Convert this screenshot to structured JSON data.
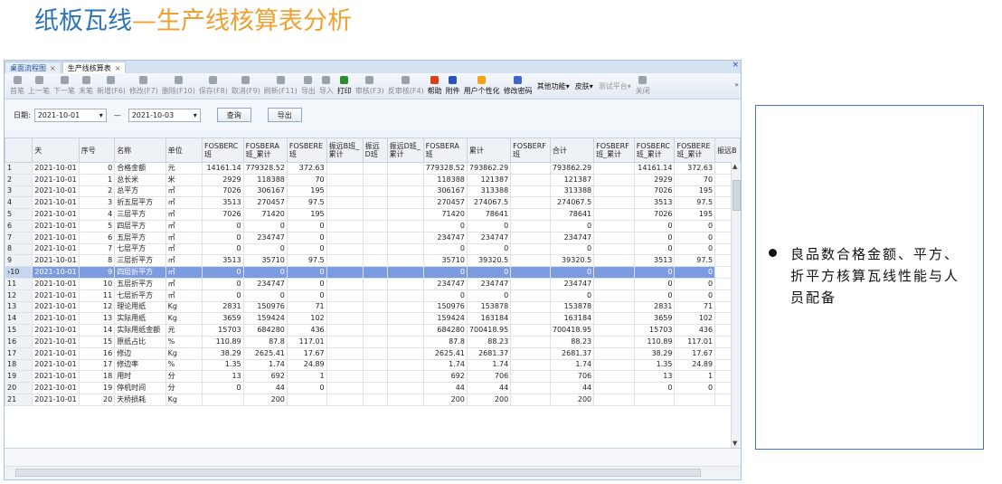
{
  "slide": {
    "title_main": "纸板瓦线",
    "title_accent": "—生产线核算表分析"
  },
  "tabs": [
    {
      "label": "桌面流程图",
      "close": "×"
    },
    {
      "label": "生产线核算表",
      "close": "×"
    }
  ],
  "window_close": "×",
  "toolbar": {
    "buttons": [
      "首笔",
      "上一笔",
      "下一笔",
      "末笔",
      "新增(F6)",
      "修改(F7)",
      "删除(F10)",
      "保存(F8)",
      "取消(F9)",
      "刷新(F11)",
      "导出",
      "导入",
      "打印",
      "审核(F3)",
      "反审核(F4)",
      "帮助",
      "附件",
      "用户个性化",
      "修改密码"
    ],
    "dropdowns": [
      "其他功能",
      "皮肤",
      "测试平台"
    ],
    "close_label": "关闭",
    "more": "»"
  },
  "filter": {
    "label": "日期:",
    "start": "2021-10-01",
    "end": "2021-10-03",
    "dash": "—",
    "query": "查询",
    "export": "导出"
  },
  "columns": [
    "天",
    "序号",
    "名称",
    "单位",
    "FOSBERC班",
    "FOSBERA班_累计",
    "FOSBERE班",
    "振远B班_累计",
    "振远D班",
    "振远D班_累计",
    "FOSBERA班",
    "累计",
    "FOSBERF班",
    "合计",
    "FOSBERF班_累计",
    "FOSBERC班_累计",
    "FOSBERE班_累计",
    "振远B"
  ],
  "rows": [
    {
      "no": "1",
      "day": "2021-10-01",
      "seq": "0",
      "name": "合格金额",
      "unit": "元",
      "c": [
        "14161.14",
        "779328.52",
        "372.63",
        "",
        "",
        "",
        "779328.52",
        "793862.29",
        "",
        "793862.29",
        "",
        "14161.14",
        "372.63"
      ]
    },
    {
      "no": "2",
      "day": "2021-10-01",
      "seq": "1",
      "name": "总长米",
      "unit": "米",
      "c": [
        "2929",
        "118388",
        "70",
        "",
        "",
        "",
        "118388",
        "121387",
        "",
        "121387",
        "",
        "2929",
        "70"
      ]
    },
    {
      "no": "3",
      "day": "2021-10-01",
      "seq": "2",
      "name": "总平方",
      "unit": "㎡",
      "c": [
        "7026",
        "306167",
        "195",
        "",
        "",
        "",
        "306167",
        "313388",
        "",
        "313388",
        "",
        "7026",
        "195"
      ]
    },
    {
      "no": "4",
      "day": "2021-10-01",
      "seq": "3",
      "name": "折五层平方",
      "unit": "㎡",
      "c": [
        "3513",
        "270457",
        "97.5",
        "",
        "",
        "",
        "270457",
        "274067.5",
        "",
        "274067.5",
        "",
        "3513",
        "97.5"
      ]
    },
    {
      "no": "5",
      "day": "2021-10-01",
      "seq": "4",
      "name": "三层平方",
      "unit": "㎡",
      "c": [
        "7026",
        "71420",
        "195",
        "",
        "",
        "",
        "71420",
        "78641",
        "",
        "78641",
        "",
        "7026",
        "195"
      ]
    },
    {
      "no": "6",
      "day": "2021-10-01",
      "seq": "5",
      "name": "四层平方",
      "unit": "㎡",
      "c": [
        "0",
        "0",
        "0",
        "",
        "",
        "",
        "0",
        "0",
        "",
        "0",
        "",
        "0",
        "0"
      ]
    },
    {
      "no": "7",
      "day": "2021-10-01",
      "seq": "6",
      "name": "五层平方",
      "unit": "㎡",
      "c": [
        "0",
        "234747",
        "0",
        "",
        "",
        "",
        "234747",
        "234747",
        "",
        "234747",
        "",
        "0",
        "0"
      ]
    },
    {
      "no": "8",
      "day": "2021-10-01",
      "seq": "7",
      "name": "七层平方",
      "unit": "㎡",
      "c": [
        "0",
        "0",
        "0",
        "",
        "",
        "",
        "0",
        "0",
        "",
        "0",
        "",
        "0",
        "0"
      ]
    },
    {
      "no": "9",
      "day": "2021-10-01",
      "seq": "8",
      "name": "三层折平方",
      "unit": "㎡",
      "c": [
        "3513",
        "35710",
        "97.5",
        "",
        "",
        "",
        "35710",
        "39320.5",
        "",
        "39320.5",
        "",
        "3513",
        "97.5"
      ]
    },
    {
      "no": "›10",
      "day": "2021-10-01",
      "seq": "9",
      "name": "四层折平方",
      "unit": "㎡",
      "c": [
        "0",
        "0",
        "0",
        "",
        "",
        "",
        "0",
        "0",
        "",
        "0",
        "",
        "0",
        "0"
      ]
    },
    {
      "no": "11",
      "day": "2021-10-01",
      "seq": "10",
      "name": "五层折平方",
      "unit": "㎡",
      "c": [
        "0",
        "234747",
        "0",
        "",
        "",
        "",
        "234747",
        "234747",
        "",
        "234747",
        "",
        "0",
        "0"
      ]
    },
    {
      "no": "12",
      "day": "2021-10-01",
      "seq": "11",
      "name": "七层折平方",
      "unit": "㎡",
      "c": [
        "0",
        "0",
        "0",
        "",
        "",
        "",
        "0",
        "0",
        "",
        "0",
        "",
        "0",
        "0"
      ]
    },
    {
      "no": "13",
      "day": "2021-10-01",
      "seq": "12",
      "name": "理论用纸",
      "unit": "Kg",
      "c": [
        "2831",
        "150976",
        "71",
        "",
        "",
        "",
        "150976",
        "153878",
        "",
        "153878",
        "",
        "2831",
        "71"
      ]
    },
    {
      "no": "14",
      "day": "2021-10-01",
      "seq": "13",
      "name": "实际用纸",
      "unit": "Kg",
      "c": [
        "3659",
        "159424",
        "102",
        "",
        "",
        "",
        "159424",
        "163184",
        "",
        "163184",
        "",
        "3659",
        "102"
      ]
    },
    {
      "no": "15",
      "day": "2021-10-01",
      "seq": "14",
      "name": "实际用纸金额",
      "unit": "元",
      "c": [
        "15703",
        "684280",
        "436",
        "",
        "",
        "",
        "684280",
        "700418.95",
        "",
        "700418.95",
        "",
        "15703",
        "436"
      ]
    },
    {
      "no": "16",
      "day": "2021-10-01",
      "seq": "15",
      "name": "原纸占比",
      "unit": "%",
      "c": [
        "110.89",
        "87.8",
        "117.01",
        "",
        "",
        "",
        "87.8",
        "88.23",
        "",
        "88.23",
        "",
        "110.89",
        "117.01"
      ]
    },
    {
      "no": "17",
      "day": "2021-10-01",
      "seq": "16",
      "name": "修边",
      "unit": "Kg",
      "c": [
        "38.29",
        "2625.41",
        "17.67",
        "",
        "",
        "",
        "2625.41",
        "2681.37",
        "",
        "2681.37",
        "",
        "38.29",
        "17.67"
      ]
    },
    {
      "no": "18",
      "day": "2021-10-01",
      "seq": "17",
      "name": "修边率",
      "unit": "%",
      "c": [
        "1.35",
        "1.74",
        "24.89",
        "",
        "",
        "",
        "1.74",
        "1.74",
        "",
        "1.74",
        "",
        "1.35",
        "24.89"
      ]
    },
    {
      "no": "19",
      "day": "2021-10-01",
      "seq": "18",
      "name": "用时",
      "unit": "分",
      "c": [
        "13",
        "692",
        "1",
        "",
        "",
        "",
        "692",
        "706",
        "",
        "706",
        "",
        "13",
        "1"
      ]
    },
    {
      "no": "20",
      "day": "2021-10-01",
      "seq": "19",
      "name": "停机时间",
      "unit": "分",
      "c": [
        "0",
        "44",
        "0",
        "",
        "",
        "",
        "44",
        "44",
        "",
        "44",
        "",
        "0",
        "0"
      ]
    },
    {
      "no": "21",
      "day": "2021-10-01",
      "seq": "20",
      "name": "天桥损耗",
      "unit": "Kg",
      "c": [
        "",
        "200",
        "",
        "",
        "",
        "",
        "200",
        "200",
        "",
        "200",
        "",
        "",
        ""
      ]
    }
  ],
  "selected_row": 9,
  "note": {
    "text": "良品数合格金额、平方、折平方核算瓦线性能与人员配备"
  },
  "colors": {
    "title_blue": "#2e75b6",
    "title_orange": "#f0a030",
    "selection": "#7d9be0",
    "note_border": "#4472c4"
  }
}
